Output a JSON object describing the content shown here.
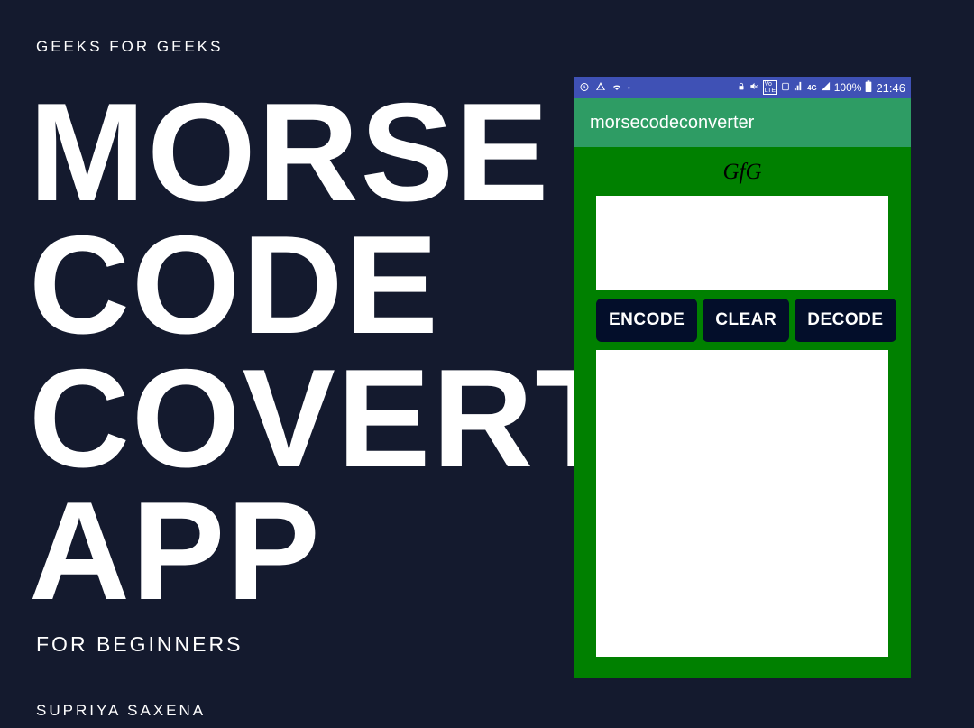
{
  "brand": "GEEKS  FOR GEEKS",
  "title_lines": [
    "MORSE",
    "CODE",
    "COVERTER",
    "APP"
  ],
  "subtitle": "FOR BEGINNERS",
  "author": "SUPRIYA SAXENA",
  "phone": {
    "status": {
      "battery_text": "100%",
      "time": "21:46"
    },
    "app_title": "morsecodeconverter",
    "body_label": "GfG",
    "buttons": {
      "encode": "ENCODE",
      "clear": "CLEAR",
      "decode": "DECODE"
    }
  }
}
